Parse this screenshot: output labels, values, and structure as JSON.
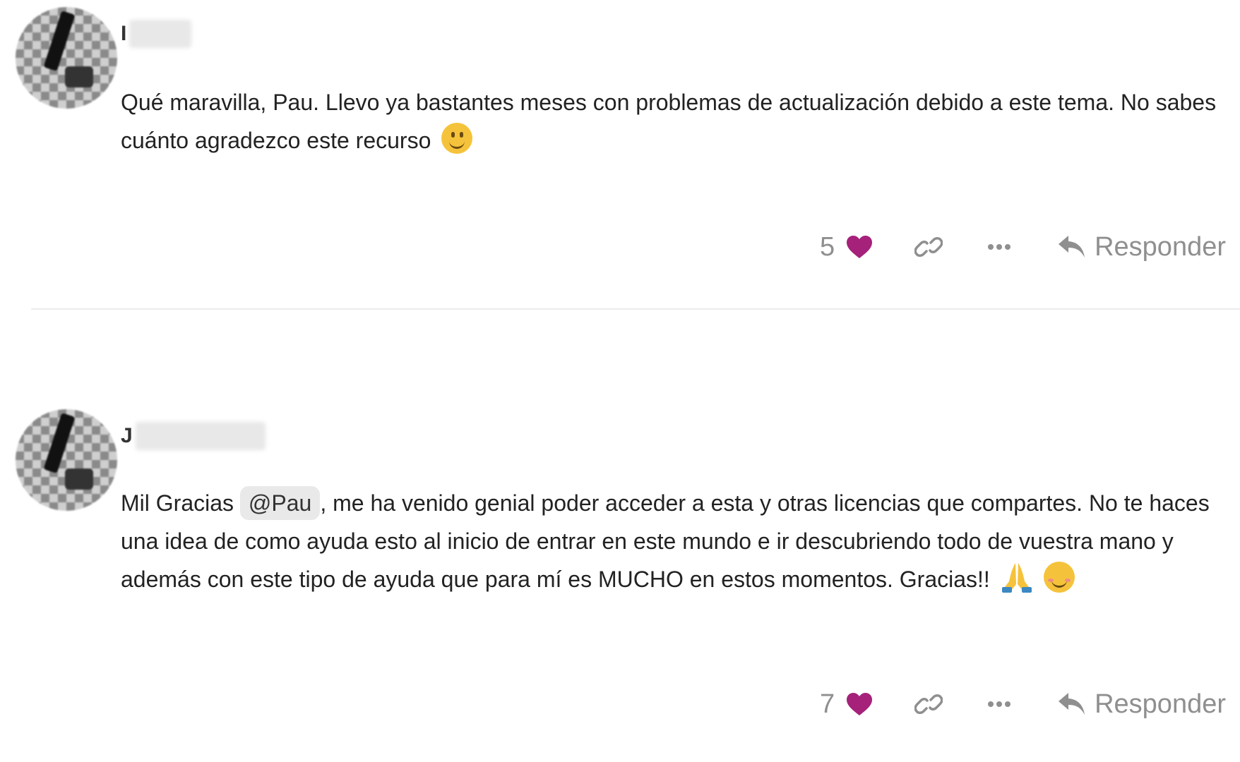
{
  "posts": [
    {
      "author_initial": "I",
      "text": "Qué maravilla, Pau. Llevo ya bastantes meses con problemas de actualización debido a este tema. No sabes cuánto agradezco este recurso",
      "likes": "5",
      "reply_label": "Responder",
      "emojis": [
        "slightly-smiling-face"
      ]
    },
    {
      "author_initial": "J",
      "text_before_mention": "Mil Gracias",
      "mention": "@Pau",
      "text_after_mention": ", me ha venido genial poder acceder a esta y otras licencias que compartes. No te haces una idea de como ayuda esto al inicio de entrar en este mundo e ir descubriendo todo de vuestra mano y además con este tipo de ayuda que para mí es MUCHO en estos momentos. Gracias!!",
      "likes": "7",
      "reply_label": "Responder",
      "emojis": [
        "folded-hands",
        "smiling-face-with-smiling-eyes"
      ]
    }
  ],
  "colors": {
    "heart": "#a5217a",
    "muted": "#8f8f8f",
    "text": "#222222",
    "mention_bg": "#e9e9e9",
    "divider": "#ececec"
  },
  "icons": {
    "like": "heart-icon",
    "link": "link-icon",
    "more": "ellipsis-icon",
    "reply": "reply-arrow-icon"
  }
}
